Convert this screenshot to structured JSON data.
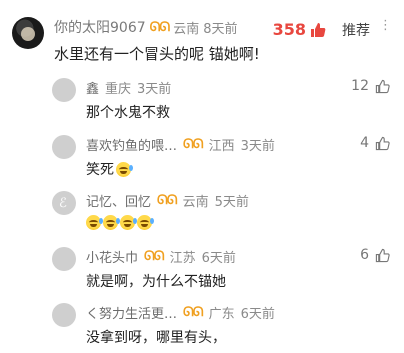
{
  "main_comment": {
    "username": "你的太阳9067",
    "location": "云南",
    "time": "8天前",
    "likes": "358",
    "recommend_label": "推荐",
    "text": "水里还有一个冒头的呢 锚她啊!"
  },
  "replies": [
    {
      "username": "鑫",
      "location": "重庆",
      "time": "3天前",
      "likes": "12",
      "text": "那个水鬼不救",
      "emojis": 0
    },
    {
      "username": "喜欢钓鱼的喂…",
      "location": "江西",
      "time": "3天前",
      "likes": "4",
      "text": "笑死",
      "emojis": 1
    },
    {
      "username": "记忆、回忆",
      "location": "云南",
      "time": "5天前",
      "likes": "",
      "text": "",
      "emojis": 4
    },
    {
      "username": "小花头巾",
      "location": "江苏",
      "time": "6天前",
      "likes": "6",
      "text": "就是啊，为什么不锚她",
      "emojis": 0
    },
    {
      "username": "く努力生活更…",
      "location": "广东",
      "time": "6天前",
      "likes": "",
      "text": "没拿到呀，哪里有头，",
      "emojis": 0
    }
  ],
  "icons": {
    "vip": "vip-badge-icon",
    "thumb": "thumb-up-icon",
    "emoji": "laughing-tears-emoji"
  },
  "colors": {
    "like_red": "#e8473f",
    "vip_gold": "#f0a020"
  }
}
